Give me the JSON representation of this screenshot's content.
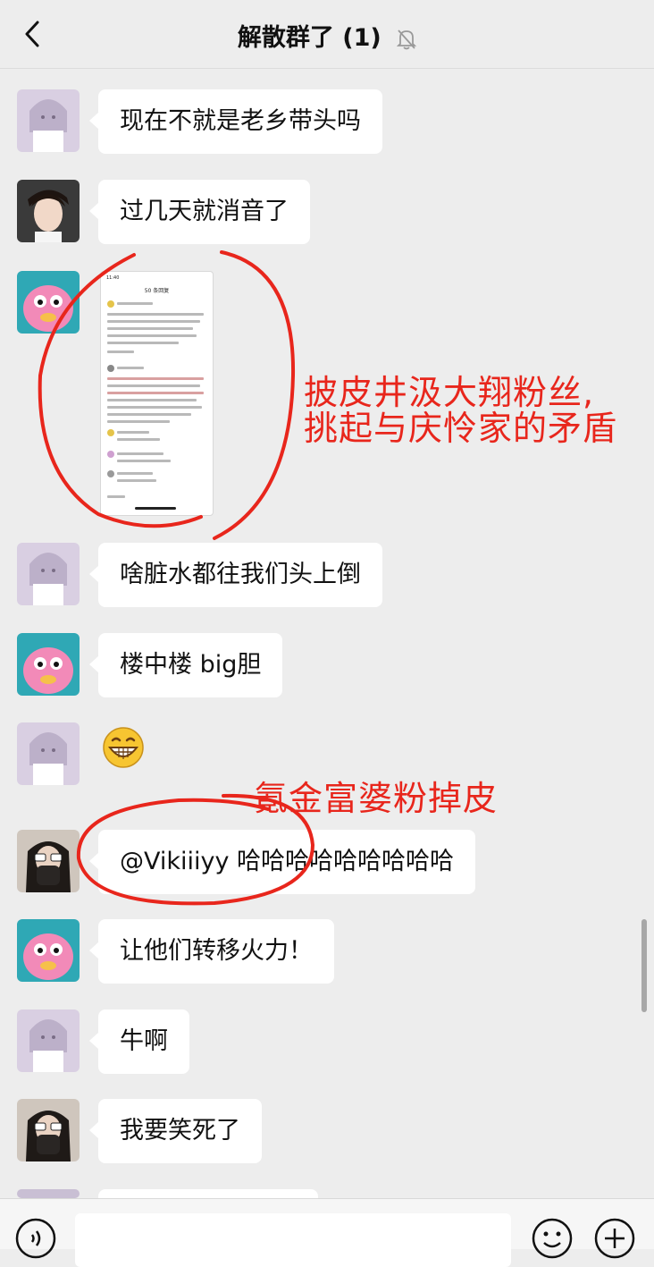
{
  "header": {
    "title": "解散群了 (1)",
    "back_icon": "chevron-left-icon",
    "mute_icon": "bell-slash-icon"
  },
  "messages": [
    {
      "avatar": "anime-girl-avatar",
      "text": "现在不就是老乡带头吗"
    },
    {
      "avatar": "young-man-avatar",
      "text": "过几天就消音了"
    },
    {
      "avatar": "pink-monster-avatar",
      "type": "image"
    },
    {
      "avatar": "anime-girl-avatar",
      "text": "啥脏水都往我们头上倒"
    },
    {
      "avatar": "pink-monster-avatar",
      "text": "楼中楼 big胆"
    },
    {
      "avatar": "anime-girl-avatar",
      "type": "emoji",
      "emoji": "grin-emoji"
    },
    {
      "avatar": "sunglasses-girl-avatar",
      "text": "@Vikiiiyy 哈哈哈哈哈哈哈哈哈"
    },
    {
      "avatar": "pink-monster-avatar",
      "text": "让他们转移火力！"
    },
    {
      "avatar": "anime-girl-avatar",
      "text": "牛啊"
    },
    {
      "avatar": "sunglasses-girl-avatar",
      "text": "我要笑死了"
    }
  ],
  "screenshot_image": {
    "status_time": "11:40",
    "title": "50 条回复"
  },
  "annotations": {
    "line1": "披皮井汲大翔粉丝,",
    "line2": "挑起与庆怜家的矛盾",
    "line3": "氪金富婆粉掉皮",
    "color": "#e8261c"
  },
  "input_bar": {
    "voice_icon": "voice-icon",
    "emoji_icon": "smiley-icon",
    "plus_icon": "plus-icon"
  }
}
